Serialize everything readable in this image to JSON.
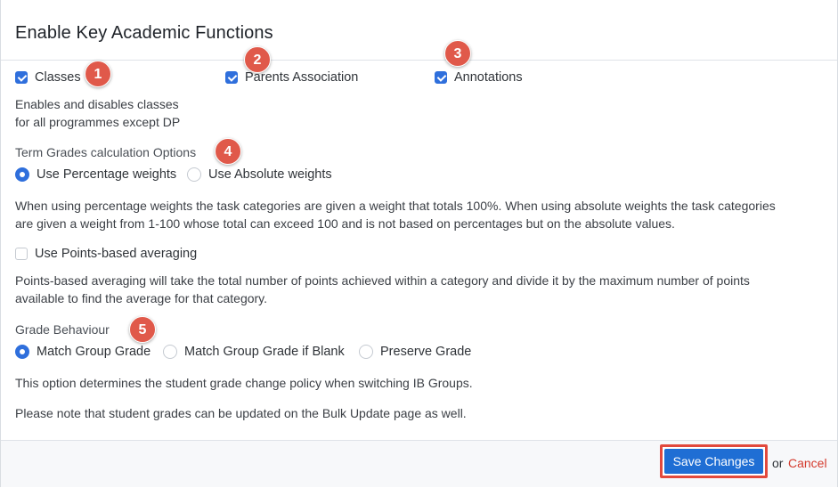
{
  "header": {
    "title": "Enable Key Academic Functions"
  },
  "functions": {
    "classes": {
      "label": "Classes",
      "checked": true
    },
    "parents": {
      "label": "Parents Association",
      "checked": true
    },
    "annotations": {
      "label": "Annotations",
      "checked": true
    },
    "classes_help_1": "Enables and disables classes",
    "classes_help_2": "for all programmes except DP"
  },
  "term_grades": {
    "label": "Term Grades calculation Options",
    "options": [
      {
        "label": "Use Percentage weights",
        "selected": true
      },
      {
        "label": "Use Absolute weights",
        "selected": false
      }
    ],
    "help_1": "When using percentage weights the task categories are given a weight that totals 100%. When using absolute weights the task categories",
    "help_2": "are given a weight from 1-100 whose total can exceed 100 and is not based on percentages but on the absolute values."
  },
  "points": {
    "label": "Use Points-based averaging",
    "checked": false,
    "help_1": "Points-based averaging will take the total number of points achieved within a category and divide it by the maximum number of points",
    "help_2": "available to find the average for that category."
  },
  "grade_behaviour": {
    "label": "Grade Behaviour",
    "options": [
      {
        "label": "Match Group Grade",
        "selected": true
      },
      {
        "label": "Match Group Grade if Blank",
        "selected": false
      },
      {
        "label": "Preserve Grade",
        "selected": false
      }
    ],
    "help": "This option determines the student grade change policy when switching IB Groups.",
    "note": "Please note that student grades can be updated on the Bulk Update page as well."
  },
  "badges": [
    "1",
    "2",
    "3",
    "4",
    "5"
  ],
  "footer": {
    "save_label": "Save Changes",
    "or_text": "or",
    "cancel_label": "Cancel"
  },
  "colors": {
    "accent": "#1f6ed4",
    "checkbox": "#2f6fdc",
    "badge": "#e0594a",
    "cancel": "#d43b2e",
    "highlight": "#e2493d"
  },
  "icons": {
    "checkbox_checked": "checkmark-icon",
    "radio_selected": "radio-dot-icon"
  }
}
